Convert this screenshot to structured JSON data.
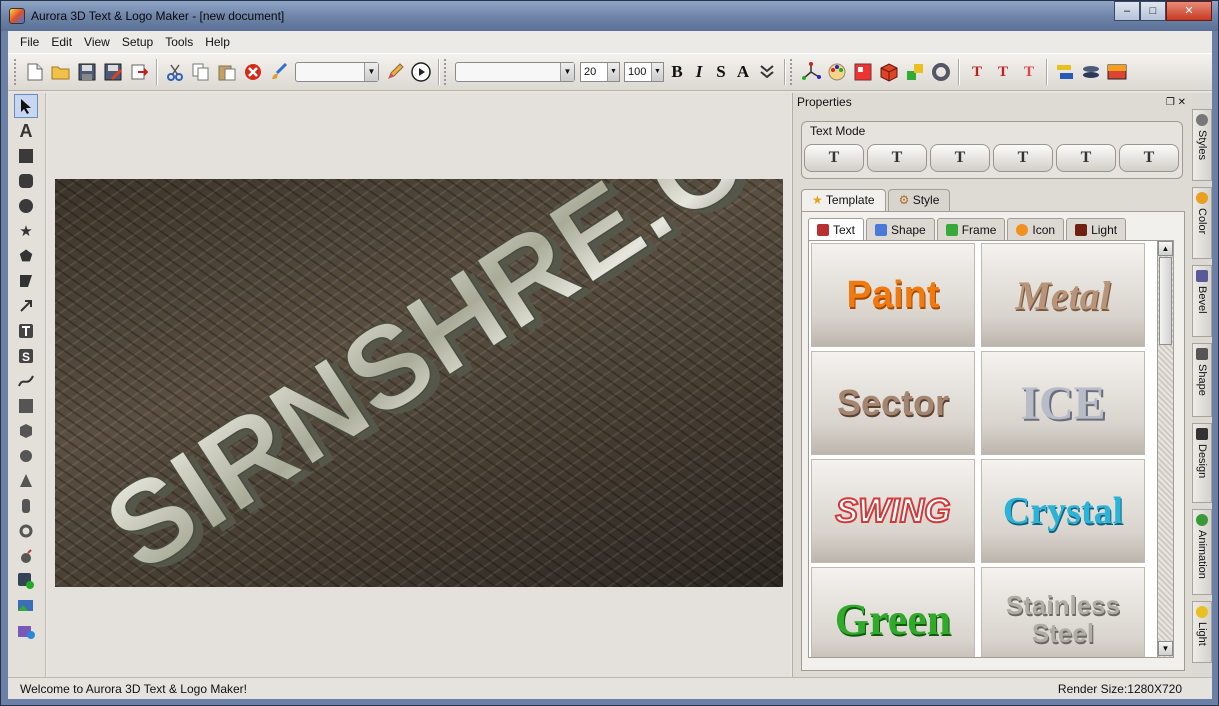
{
  "window": {
    "title": "Aurora 3D Text & Logo Maker - [new document]",
    "min": "‒",
    "max": "□",
    "close": "✕"
  },
  "menu": [
    "File",
    "Edit",
    "View",
    "Setup",
    "Tools",
    "Help"
  ],
  "toolbar": {
    "font_size": "20",
    "font_scale": "100",
    "bold": "B",
    "italic": "I",
    "strike": "S",
    "outline": "A"
  },
  "properties": {
    "title": "Properties",
    "text_mode": {
      "label": "Text Mode",
      "buttons": [
        "T",
        "T",
        "T",
        "T",
        "T",
        "T"
      ]
    },
    "main_tabs": [
      "Template",
      "Style"
    ],
    "sub_tabs": [
      "Text",
      "Shape",
      "Frame",
      "Icon",
      "Light"
    ],
    "templates": [
      {
        "label": "Paint",
        "color": "#f07a10"
      },
      {
        "label": "Metal",
        "color": "#b89478"
      },
      {
        "label": "Sector",
        "color": "#a48670"
      },
      {
        "label": "ICE",
        "color": "#b8bcc8"
      },
      {
        "label": "SWING",
        "color": "#d23a3a"
      },
      {
        "label": "Crystal",
        "color": "#2ab4d8"
      },
      {
        "label": "Green",
        "color": "#2faa2a"
      },
      {
        "label": "Stainless Steel",
        "color": "#b0aca6"
      }
    ]
  },
  "side_tabs": [
    "Styles",
    "Color",
    "Bevel",
    "Shape",
    "Design",
    "Animation",
    "Light"
  ],
  "canvas": {
    "text": "SIRNSHRE.COM"
  },
  "status": {
    "message": "Welcome to Aurora 3D Text & Logo Maker!",
    "render_size": "Render Size:1280X720"
  },
  "colors": {
    "accent": "#6a80a6",
    "panel": "#dedbd5"
  }
}
